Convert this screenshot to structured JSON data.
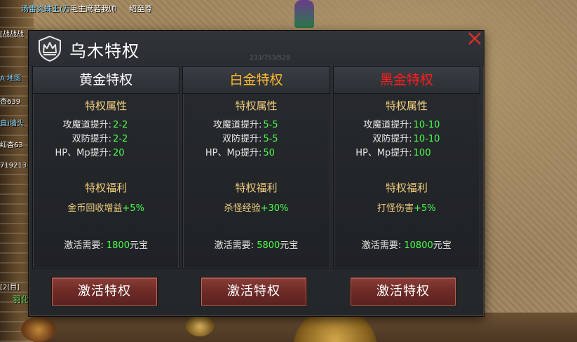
{
  "window": {
    "title": "乌木特权",
    "coords_text": "233/753/529"
  },
  "chat": {
    "top_name": "汤雷炎蛛王(万",
    "top_text": "毛主席若我帅",
    "top_tail": "绍至尊",
    "side_lines": [
      "[战战战",
      "A 地图",
      "杏639",
      "直)墙头",
      "红杏63",
      "719213"
    ],
    "bottom_tag": "[2(目]",
    "bottom_name": "羽化"
  },
  "tiers": [
    {
      "name": "黄金特权",
      "name_color": "#ffffff",
      "attr_title": "特权属性",
      "attrs": [
        {
          "label": "攻魔道提升:",
          "value": "2-2"
        },
        {
          "label": "双防提升:",
          "value": "2-2"
        },
        {
          "label": "HP、Mp提升:",
          "value": "20"
        }
      ],
      "welfare_title": "特权福利",
      "benefit_text": "金币回收增益",
      "benefit_bonus": "+5%",
      "cost_label": "激活需要:",
      "cost_amount": "1800",
      "cost_unit": "元宝",
      "button_label": "激活特权"
    },
    {
      "name": "白金特权",
      "name_color": "#ffb82e",
      "attr_title": "特权属性",
      "attrs": [
        {
          "label": "攻魔道提升:",
          "value": "5-5"
        },
        {
          "label": "双防提升:",
          "value": "5-5"
        },
        {
          "label": "HP、Mp提升:",
          "value": "50"
        }
      ],
      "welfare_title": "特权福利",
      "benefit_text": "杀怪经验",
      "benefit_bonus": "+30%",
      "cost_label": "激活需要:",
      "cost_amount": "5800",
      "cost_unit": "元宝",
      "button_label": "激活特权"
    },
    {
      "name": "黑金特权",
      "name_color": "#ff1c1c",
      "attr_title": "特权属性",
      "attrs": [
        {
          "label": "攻魔道提升:",
          "value": "10-10"
        },
        {
          "label": "双防提升:",
          "value": "10-10"
        },
        {
          "label": "HP、Mp提升:",
          "value": "100"
        }
      ],
      "welfare_title": "特权福利",
      "benefit_text": "打怪伤害",
      "benefit_bonus": "+5%",
      "cost_label": "激活需要:",
      "cost_amount": "10800",
      "cost_unit": "元宝",
      "button_label": "激活特权"
    }
  ],
  "icons": {
    "emblem": "crown-shield-icon",
    "close": "close-x-icon"
  },
  "colors": {
    "accent_gold": "#f2cf7e",
    "value_green": "#4cff4c",
    "close_red": "#d8302a",
    "button_red": "#7a302b"
  }
}
